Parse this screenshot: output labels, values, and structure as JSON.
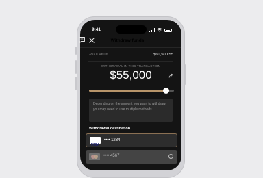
{
  "status_bar": {
    "time": "9:41"
  },
  "header": {
    "title": "Withdraw funds",
    "chat_icon": "chat-icon",
    "close_icon": "close-icon"
  },
  "available": {
    "label": "AVAILABLE",
    "value": "$60,500.55"
  },
  "transaction": {
    "label": "WITHDRAWAL IN THIS TRANSACTION",
    "amount": "$55,000"
  },
  "slider": {
    "fraction": 0.91,
    "fill_color": "#b8956a"
  },
  "info": {
    "text": "Depending on the amount you want to withdraw, you may need to use multiple methods."
  },
  "destination": {
    "title": "Withdrawal destination",
    "cards": [
      {
        "brand": "VISA",
        "number": "•••• 1234",
        "selected": true
      },
      {
        "brand": "mastercard",
        "number": "•••• 4567",
        "selected": false,
        "icon": "info-icon"
      }
    ]
  },
  "colors": {
    "background": "#ececee",
    "screen": "#141414",
    "accent": "#b8956a"
  }
}
